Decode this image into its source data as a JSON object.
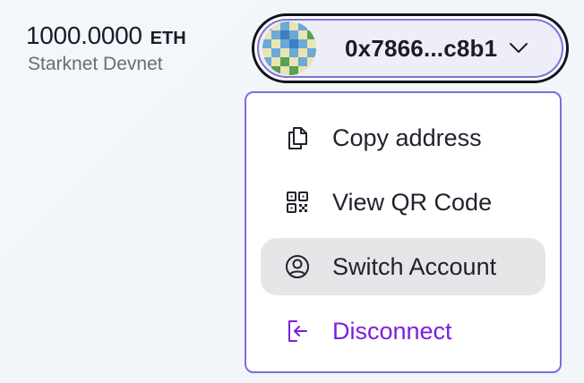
{
  "wallet": {
    "balance_amount": "1000.0000",
    "balance_unit": "ETH",
    "network_name": "Starknet Devnet"
  },
  "account_button": {
    "address_short": "0x7866...c8b1",
    "avatar_icon": "identicon-avatar",
    "chevron_icon": "chevron-down-icon"
  },
  "menu": {
    "items": [
      {
        "label": "Copy address",
        "icon": "copy-icon"
      },
      {
        "label": "View QR Code",
        "icon": "qr-code-icon"
      },
      {
        "label": "Switch Account",
        "icon": "user-circle-icon",
        "highlighted": true
      },
      {
        "label": "Disconnect",
        "icon": "logout-icon",
        "color": "#7c1fe0"
      }
    ]
  },
  "colors": {
    "accent_purple": "#7c1fe0",
    "border_purple": "#7b6ee0",
    "hover_gray": "#e6e6e8"
  }
}
